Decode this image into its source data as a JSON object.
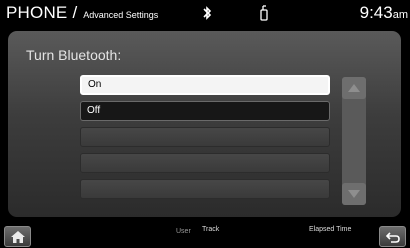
{
  "header": {
    "app_title": "PHONE",
    "separator": "/",
    "subtitle": "Advanced Settings",
    "bluetooth_icon": "bluetooth-icon",
    "phone_signal_icon": "phone-signal-icon",
    "time": "9:43",
    "time_suffix": "am"
  },
  "panel": {
    "title": "Turn Bluetooth:",
    "options": [
      {
        "label": "On",
        "state": "highlighted"
      },
      {
        "label": "Off",
        "state": "selected"
      }
    ],
    "empty_rows": 3
  },
  "scrollbar": {
    "up_icon": "triangle-up-icon",
    "down_icon": "triangle-down-icon"
  },
  "footer": {
    "home_icon": "home-icon",
    "user_label": "User",
    "track_label": "Track",
    "elapsed_label": "Elapsed Time",
    "back_icon": "back-arrow-icon"
  },
  "colors": {
    "background": "#000000",
    "panel_top": "#5a5a5a",
    "panel_bottom": "#2b2b2b",
    "highlight": "#f4f4f4"
  }
}
